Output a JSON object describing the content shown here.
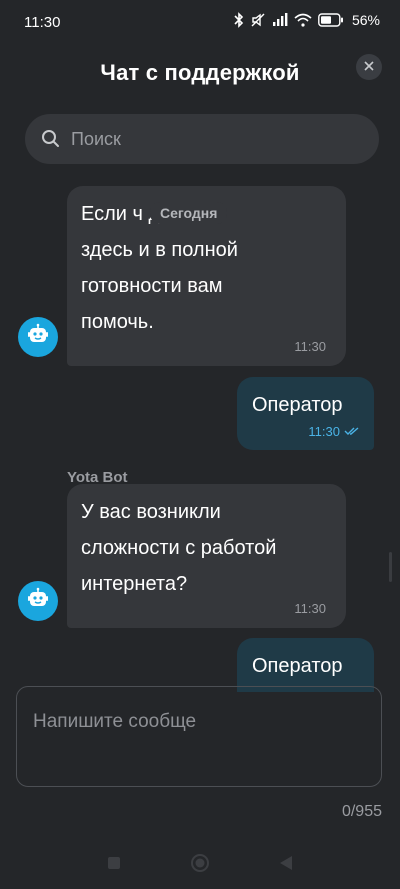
{
  "status_bar": {
    "time": "11:30",
    "battery": "56%",
    "icons": [
      "bluetooth-icon",
      "mute-icon",
      "signal-icon",
      "wifi-icon",
      "battery-icon"
    ]
  },
  "header": {
    "title": "Чат с поддержкой",
    "close_icon": "close-icon"
  },
  "search": {
    "placeholder": "Поиск",
    "icon": "search-icon"
  },
  "chat": {
    "date_chip": "Сегодня",
    "messages": [
      {
        "direction": "in",
        "sender": "",
        "text": "Если ч          да\nздесь и в полной\nготовности вам\nпомочь.",
        "time": "11:30"
      },
      {
        "direction": "out",
        "text": "Оператор",
        "time": "11:30",
        "status": "read"
      },
      {
        "direction": "in",
        "sender": "Yota Bot",
        "text": "У вас возникли\nсложности с работой\nинтернета?",
        "time": "11:30"
      },
      {
        "direction": "out",
        "text": "Оператор",
        "time": "",
        "status": ""
      }
    ]
  },
  "composer": {
    "placeholder": "Напишите сообще",
    "counter": "0/955"
  },
  "colors": {
    "background": "#242629",
    "incoming_bubble": "#35373b",
    "outgoing_bubble": "#1f3a47",
    "accent": "#4ab3e6",
    "avatar": "#1aa6de"
  },
  "navbar": {
    "icons": [
      "recents-icon",
      "home-icon",
      "back-icon"
    ]
  }
}
